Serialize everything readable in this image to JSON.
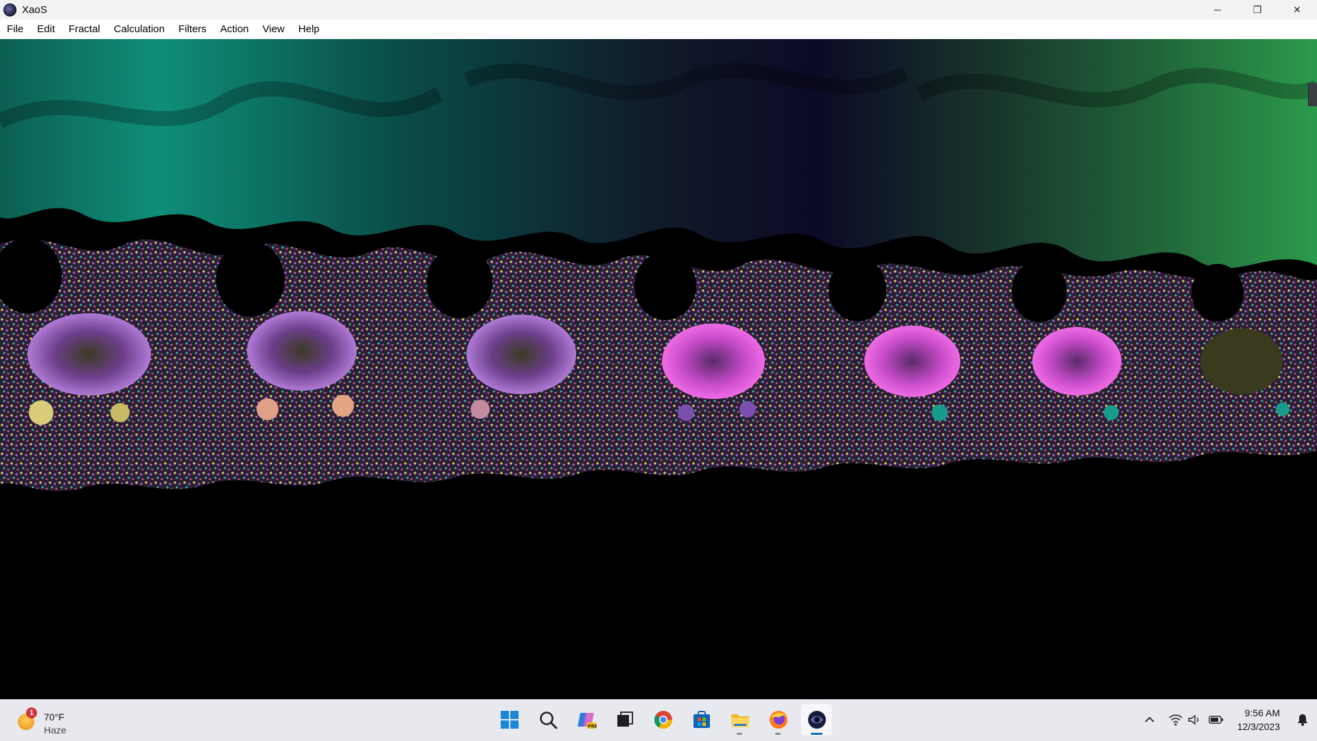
{
  "window": {
    "title": "XaoS",
    "controls": {
      "minimize": "─",
      "restore": "❐",
      "close": "✕"
    }
  },
  "menu": {
    "items": [
      "File",
      "Edit",
      "Fractal",
      "Calculation",
      "Filters",
      "Action",
      "View",
      "Help"
    ]
  },
  "canvas": {
    "content": "fractal-render",
    "palette": {
      "sky_left": "#0b6f63",
      "sky_mid": "#0c0a26",
      "sky_right": "#2a8f4a",
      "magenta": "#e14fd6",
      "violet": "#9a64c8",
      "yellow": "#d8c46a",
      "teal": "#179b8c"
    }
  },
  "taskbar": {
    "weather": {
      "badge": "1",
      "temp": "70°F",
      "desc": "Haze",
      "icon": "weather-haze-icon"
    },
    "apps": [
      {
        "name": "start-icon",
        "active": false
      },
      {
        "name": "search-icon",
        "active": false
      },
      {
        "name": "copilot-icon",
        "active": false
      },
      {
        "name": "task-view-icon",
        "active": false
      },
      {
        "name": "chrome-icon",
        "active": false
      },
      {
        "name": "store-icon",
        "active": false
      },
      {
        "name": "file-explorer-icon",
        "active": false
      },
      {
        "name": "firefox-icon",
        "active": false
      },
      {
        "name": "xaos-icon",
        "active": true
      }
    ],
    "tray": {
      "time": "9:56 AM",
      "date": "12/3/2023",
      "icons": [
        "chevron-up-icon",
        "wifi-icon",
        "volume-icon",
        "battery-icon",
        "notification-bell-icon"
      ]
    }
  }
}
